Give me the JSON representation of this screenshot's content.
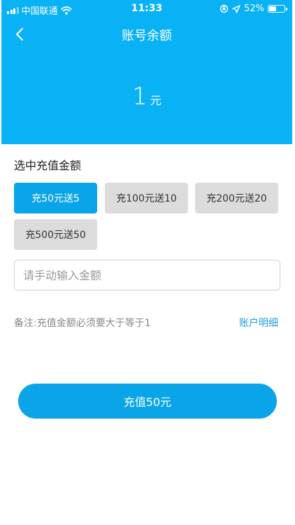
{
  "status_bar": {
    "carrier": "中国联通",
    "time": "11:33",
    "battery_text": "52%",
    "battery_level": 0.52
  },
  "header": {
    "title": "账号余额",
    "balance_value": "1",
    "balance_unit": "元"
  },
  "recharge": {
    "section_label": "选中充值金额",
    "options": [
      "充50元送5",
      "充100元送10",
      "充200元送20",
      "充500元送50"
    ],
    "selected_index": 0,
    "input_placeholder": "请手动输入金额",
    "note": "备注:充值金额必须要大于等于1",
    "detail_link": "账户明细",
    "submit_label": "充值50元"
  },
  "colors": {
    "header_bg": "#09b1f5",
    "accent": "#0aa5e8",
    "link": "#1a9fd9",
    "option_bg": "#dcdcdc"
  }
}
